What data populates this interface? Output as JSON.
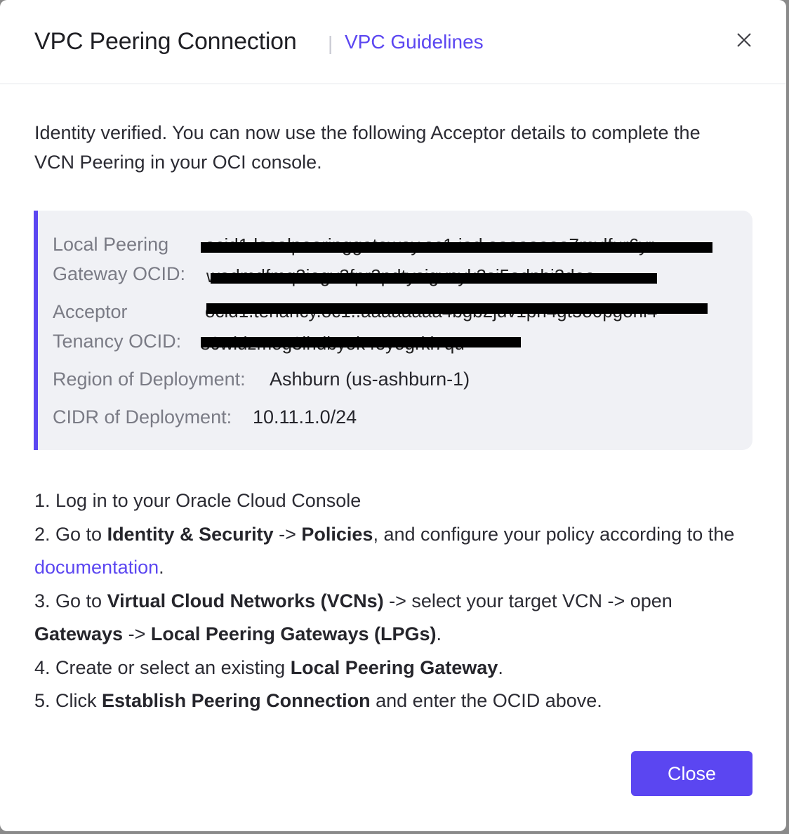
{
  "header": {
    "title": "VPC Peering Connection",
    "separator": "|",
    "guidelines_link": "VPC Guidelines",
    "close_icon": "close-icon"
  },
  "intro_text": "Identity verified. You can now use the following Acceptor details to complete the VCN Peering in your OCI console.",
  "details": {
    "local_peering_label_line1": "Local Peering",
    "local_peering_label_line2": "Gateway OCID:",
    "local_peering_value_line1": "ocid1.localpeeringgateway.oc1.iad.aaaaaaaa7mvlfur6yr",
    "local_peering_value_line2": "wadmdfmq2iegv3fpr2pdtysigvnyk2si5odnbi2daa",
    "acceptor_label_line1": "Acceptor",
    "acceptor_label_line2": "Tenancy OCID:",
    "acceptor_value_line1": "ocid1.tenancy.oc1..aaaaaaaa4bgb2jdv1ph4gt5o0pgohi4",
    "acceptor_value_line2": "s6widzmog3lhdbyok4eyogrkl7qu",
    "region_label": "Region of Deployment:",
    "region_value": "Ashburn (us-ashburn-1)",
    "cidr_label": "CIDR of Deployment:",
    "cidr_value": "10.11.1.0/24",
    "accent_color": "#5b46f1"
  },
  "steps": {
    "step1": "1. Log in to your Oracle Cloud Console",
    "step2_a": "2. Go to ",
    "step2_b": "Identity & Security",
    "step2_c": " -> ",
    "step2_d": "Policies",
    "step2_e": ", and configure your policy according to the ",
    "step2_link": "documentation",
    "step2_f": ".",
    "step3_a": "3. Go to ",
    "step3_b": "Virtual Cloud Networks (VCNs)",
    "step3_c": " -> select your target VCN -> open ",
    "step3_d": "Gateways",
    "step3_e": " -> ",
    "step3_f": "Local Peering Gateways (LPGs)",
    "step3_g": ".",
    "step4_a": "4. Create or select an existing ",
    "step4_b": "Local Peering Gateway",
    "step4_c": ".",
    "step5_a": "5. Click ",
    "step5_b": "Establish Peering Connection",
    "step5_c": " and enter the OCID above."
  },
  "footer": {
    "close_label": "Close"
  },
  "colors": {
    "primary": "#5b46f1",
    "panel_bg": "#f0f1f5"
  }
}
